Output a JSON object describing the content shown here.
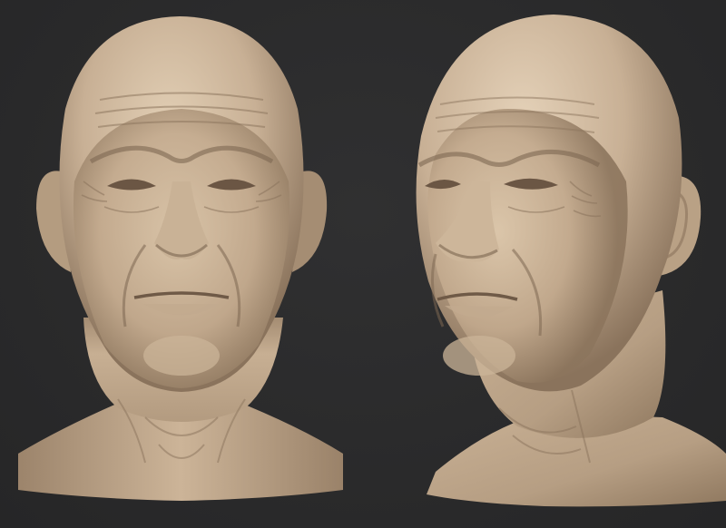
{
  "scene": {
    "background_color": "#2b2b2c",
    "clay_color": "#c9b196",
    "clay_shadow_color": "#7d6752",
    "clay_highlight_color": "#e4d1b8",
    "views": [
      {
        "id": "front",
        "description": "front"
      },
      {
        "id": "three-quarter",
        "description": "three-quarter"
      }
    ]
  }
}
